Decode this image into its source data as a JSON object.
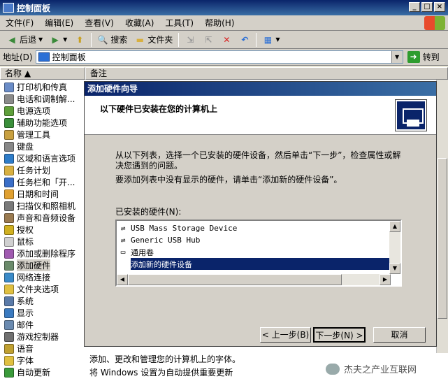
{
  "window": {
    "title": "控制面板",
    "controls": [
      "_",
      "□",
      "×"
    ]
  },
  "menu": [
    "文件(F)",
    "编辑(E)",
    "查看(V)",
    "收藏(A)",
    "工具(T)",
    "帮助(H)"
  ],
  "toolbar": {
    "back": "后退",
    "search": "搜索",
    "folders": "文件夹"
  },
  "address": {
    "label": "地址(D)",
    "value": "控制面板",
    "go": "转到"
  },
  "columns": {
    "name": "名称 ▲",
    "note": "备注"
  },
  "items": [
    {
      "label": "打印机和传真",
      "color": "#6A8CC7"
    },
    {
      "label": "电话和调制解...",
      "color": "#8A8A8A"
    },
    {
      "label": "电源选项",
      "color": "#5E9F3A"
    },
    {
      "label": "辅助功能选项",
      "color": "#3A8F3A"
    },
    {
      "label": "管理工具",
      "color": "#C8A040"
    },
    {
      "label": "键盘",
      "color": "#888888"
    },
    {
      "label": "区域和语言选项",
      "color": "#2E7CC8"
    },
    {
      "label": "任务计划",
      "color": "#D8B040"
    },
    {
      "label": "任务栏和「开...",
      "color": "#3A6EC8"
    },
    {
      "label": "日期和时间",
      "color": "#E0A030"
    },
    {
      "label": "扫描仪和照相机",
      "color": "#7A7A7A"
    },
    {
      "label": "声音和音频设备",
      "color": "#9A7A50"
    },
    {
      "label": "授权",
      "color": "#D0B020"
    },
    {
      "label": "鼠标",
      "color": "#D0D0D0"
    },
    {
      "label": "添加或删除程序",
      "color": "#A05AB0"
    },
    {
      "label": "添加硬件",
      "color": "#6A8A6A",
      "selected": true
    },
    {
      "label": "网络连接",
      "color": "#3A8AC8"
    },
    {
      "label": "文件夹选项",
      "color": "#E0C040"
    },
    {
      "label": "系统",
      "color": "#5A7AA8"
    },
    {
      "label": "显示",
      "color": "#3A7AC0"
    },
    {
      "label": "邮件",
      "color": "#6A8AB0"
    },
    {
      "label": "游戏控制器",
      "color": "#707070"
    },
    {
      "label": "语音",
      "color": "#C0A030"
    },
    {
      "label": "字体",
      "color": "#E0C040"
    },
    {
      "label": "自动更新",
      "color": "#3A9A3A"
    }
  ],
  "footer": {
    "line1": "添加、更改和管理您的计算机上的字体。",
    "line2": "将 Windows 设置为自动提供重要更新"
  },
  "dialog": {
    "title": "添加硬件向导",
    "heading": "以下硬件已安装在您的计算机上",
    "text1": "从以下列表，选择一个已安装的硬件设备，然后单击“下一步”，检查属性或解决您遇到的问题。",
    "text2": "要添加列表中没有显示的硬件，请单击“添加新的硬件设备”。",
    "list_label": "已安装的硬件(N):",
    "list": [
      {
        "label": "USB Mass Storage Device",
        "icon": "usb-icon"
      },
      {
        "label": "Generic USB Hub",
        "icon": "usb-icon"
      },
      {
        "label": "通用卷",
        "icon": "drive-icon"
      },
      {
        "label": "添加新的硬件设备",
        "icon": "",
        "selected": true
      }
    ],
    "buttons": {
      "back": "< 上一步(B)",
      "next": "下一步(N) >",
      "cancel": "取消"
    }
  },
  "watermark": "杰夫之产业互联网"
}
